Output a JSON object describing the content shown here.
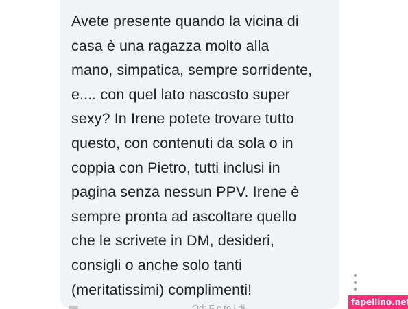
{
  "message": {
    "lines": [
      "Avete presente quando la vicina di",
      "casa è una ragazza molto alla",
      "mano, simpatica, sempre sorridente,",
      "e.... con quel lato nascosto super",
      "sexy? In Irene potete trovare tutto",
      "questo, con contenuti da sola o in",
      "coppia con Pietro, tutti inclusi in",
      "pagina senza nessun PPV. Irene è",
      "sempre pronta ad ascoltare quello",
      "che le scrivete in DM, desideri,",
      "consigli o anche solo tanti",
      "(meritatissimi) complimenti!"
    ],
    "cut_off_line": "Od: F    c    to    i di"
  },
  "icons": {
    "more": "more-vertical-icon"
  },
  "watermark": {
    "text": "fapellino.net"
  },
  "colors": {
    "bubble_background": "#f1f3f4",
    "text": "#202124",
    "watermark_background": "#ff2d78"
  }
}
